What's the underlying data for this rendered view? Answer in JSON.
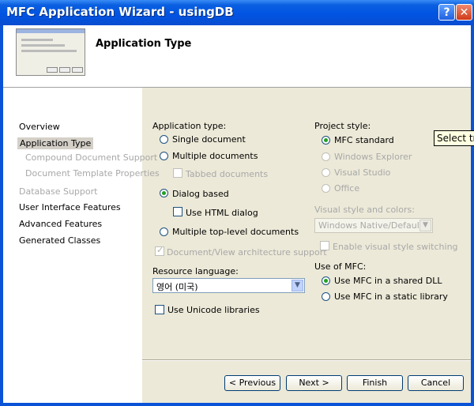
{
  "window": {
    "title": "MFC Application Wizard - usingDB",
    "help_glyph": "?",
    "close_glyph": "✕"
  },
  "header": {
    "title": "Application Type"
  },
  "sidebar": {
    "items": [
      {
        "label": "Overview"
      },
      {
        "label": "Application Type"
      },
      {
        "label": "Compound Document Support"
      },
      {
        "label": "Document Template Properties"
      },
      {
        "label": "Database Support"
      },
      {
        "label": "User Interface Features"
      },
      {
        "label": "Advanced Features"
      },
      {
        "label": "Generated Classes"
      }
    ]
  },
  "app_type": {
    "label": "Application type:",
    "single": "Single document",
    "multiple": "Multiple documents",
    "tabbed": "Tabbed documents",
    "dialog": "Dialog based",
    "html_dialog": "Use HTML dialog",
    "top_level": "Multiple top-level documents",
    "doc_view": "Document/View architecture support",
    "selected": "Dialog based"
  },
  "resource": {
    "label": "Resource language:",
    "value": "영어 (미국)",
    "unicode": "Use Unicode libraries"
  },
  "project_style": {
    "label": "Project style:",
    "mfc_standard": "MFC standard",
    "explorer": "Windows Explorer",
    "visual_studio": "Visual Studio",
    "office": "Office",
    "selected": "MFC standard"
  },
  "visual_style": {
    "label": "Visual style and colors:",
    "value": "Windows Native/Default",
    "switching": "Enable visual style switching"
  },
  "use_mfc": {
    "label": "Use of MFC:",
    "shared": "Use MFC in a shared DLL",
    "static": "Use MFC in a static library",
    "selected": "Use MFC in a shared DLL"
  },
  "buttons": {
    "previous": "< Previous",
    "next": "Next >",
    "finish": "Finish",
    "cancel": "Cancel"
  },
  "tooltip": {
    "text": "Select tra"
  }
}
